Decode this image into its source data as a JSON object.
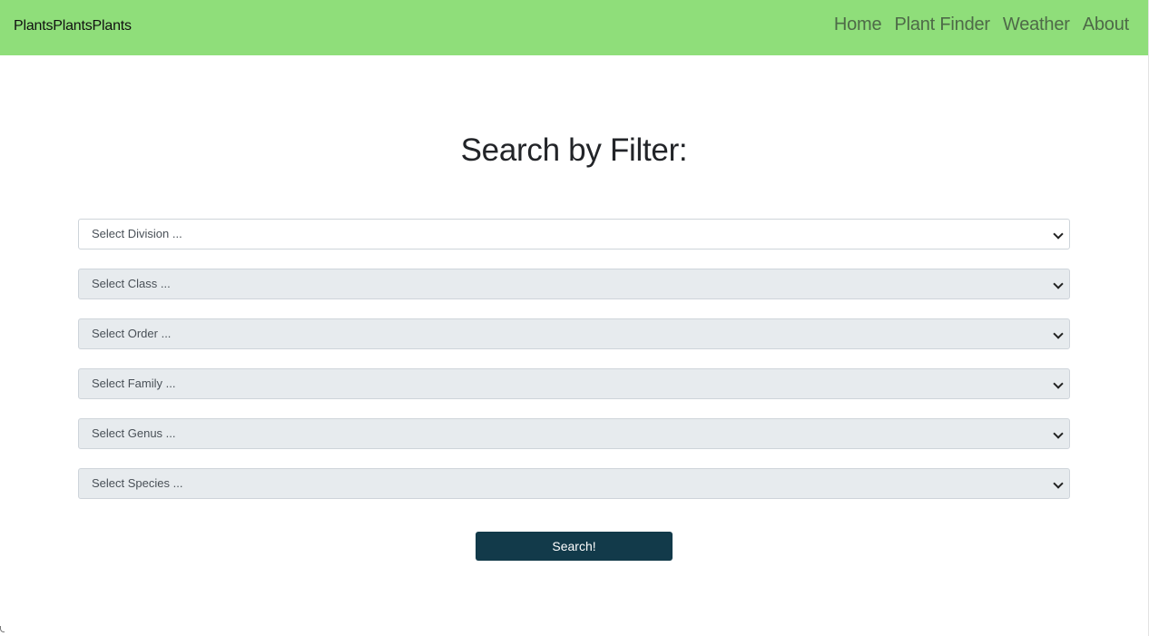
{
  "header": {
    "brand": "PlantsPlantsPlants",
    "nav": [
      "Home",
      "Plant Finder",
      "Weather",
      "About"
    ]
  },
  "main": {
    "title": "Search by Filter:",
    "filters": [
      "Select Division ...",
      "Select Class ...",
      "Select Order ...",
      "Select Family ...",
      "Select Genus ...",
      "Select Species ..."
    ],
    "search_label": "Search!"
  },
  "colors": {
    "navbar": "#8fde7a",
    "button": "#123a4a",
    "select_bg": "#e7ebee"
  }
}
